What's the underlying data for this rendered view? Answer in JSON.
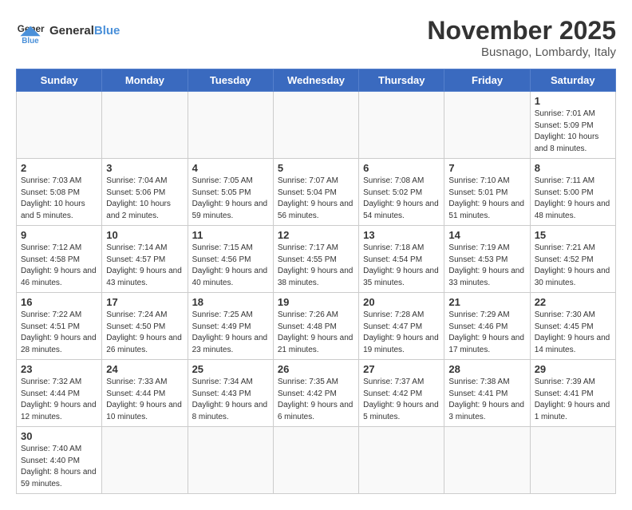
{
  "header": {
    "logo_general": "General",
    "logo_blue": "Blue",
    "month_title": "November 2025",
    "location": "Busnago, Lombardy, Italy"
  },
  "weekdays": [
    "Sunday",
    "Monday",
    "Tuesday",
    "Wednesday",
    "Thursday",
    "Friday",
    "Saturday"
  ],
  "weeks": [
    [
      {
        "day": "",
        "info": ""
      },
      {
        "day": "",
        "info": ""
      },
      {
        "day": "",
        "info": ""
      },
      {
        "day": "",
        "info": ""
      },
      {
        "day": "",
        "info": ""
      },
      {
        "day": "",
        "info": ""
      },
      {
        "day": "1",
        "info": "Sunrise: 7:01 AM\nSunset: 5:09 PM\nDaylight: 10 hours\nand 8 minutes."
      }
    ],
    [
      {
        "day": "2",
        "info": "Sunrise: 7:03 AM\nSunset: 5:08 PM\nDaylight: 10 hours\nand 5 minutes."
      },
      {
        "day": "3",
        "info": "Sunrise: 7:04 AM\nSunset: 5:06 PM\nDaylight: 10 hours\nand 2 minutes."
      },
      {
        "day": "4",
        "info": "Sunrise: 7:05 AM\nSunset: 5:05 PM\nDaylight: 9 hours\nand 59 minutes."
      },
      {
        "day": "5",
        "info": "Sunrise: 7:07 AM\nSunset: 5:04 PM\nDaylight: 9 hours\nand 56 minutes."
      },
      {
        "day": "6",
        "info": "Sunrise: 7:08 AM\nSunset: 5:02 PM\nDaylight: 9 hours\nand 54 minutes."
      },
      {
        "day": "7",
        "info": "Sunrise: 7:10 AM\nSunset: 5:01 PM\nDaylight: 9 hours\nand 51 minutes."
      },
      {
        "day": "8",
        "info": "Sunrise: 7:11 AM\nSunset: 5:00 PM\nDaylight: 9 hours\nand 48 minutes."
      }
    ],
    [
      {
        "day": "9",
        "info": "Sunrise: 7:12 AM\nSunset: 4:58 PM\nDaylight: 9 hours\nand 46 minutes."
      },
      {
        "day": "10",
        "info": "Sunrise: 7:14 AM\nSunset: 4:57 PM\nDaylight: 9 hours\nand 43 minutes."
      },
      {
        "day": "11",
        "info": "Sunrise: 7:15 AM\nSunset: 4:56 PM\nDaylight: 9 hours\nand 40 minutes."
      },
      {
        "day": "12",
        "info": "Sunrise: 7:17 AM\nSunset: 4:55 PM\nDaylight: 9 hours\nand 38 minutes."
      },
      {
        "day": "13",
        "info": "Sunrise: 7:18 AM\nSunset: 4:54 PM\nDaylight: 9 hours\nand 35 minutes."
      },
      {
        "day": "14",
        "info": "Sunrise: 7:19 AM\nSunset: 4:53 PM\nDaylight: 9 hours\nand 33 minutes."
      },
      {
        "day": "15",
        "info": "Sunrise: 7:21 AM\nSunset: 4:52 PM\nDaylight: 9 hours\nand 30 minutes."
      }
    ],
    [
      {
        "day": "16",
        "info": "Sunrise: 7:22 AM\nSunset: 4:51 PM\nDaylight: 9 hours\nand 28 minutes."
      },
      {
        "day": "17",
        "info": "Sunrise: 7:24 AM\nSunset: 4:50 PM\nDaylight: 9 hours\nand 26 minutes."
      },
      {
        "day": "18",
        "info": "Sunrise: 7:25 AM\nSunset: 4:49 PM\nDaylight: 9 hours\nand 23 minutes."
      },
      {
        "day": "19",
        "info": "Sunrise: 7:26 AM\nSunset: 4:48 PM\nDaylight: 9 hours\nand 21 minutes."
      },
      {
        "day": "20",
        "info": "Sunrise: 7:28 AM\nSunset: 4:47 PM\nDaylight: 9 hours\nand 19 minutes."
      },
      {
        "day": "21",
        "info": "Sunrise: 7:29 AM\nSunset: 4:46 PM\nDaylight: 9 hours\nand 17 minutes."
      },
      {
        "day": "22",
        "info": "Sunrise: 7:30 AM\nSunset: 4:45 PM\nDaylight: 9 hours\nand 14 minutes."
      }
    ],
    [
      {
        "day": "23",
        "info": "Sunrise: 7:32 AM\nSunset: 4:44 PM\nDaylight: 9 hours\nand 12 minutes."
      },
      {
        "day": "24",
        "info": "Sunrise: 7:33 AM\nSunset: 4:44 PM\nDaylight: 9 hours\nand 10 minutes."
      },
      {
        "day": "25",
        "info": "Sunrise: 7:34 AM\nSunset: 4:43 PM\nDaylight: 9 hours\nand 8 minutes."
      },
      {
        "day": "26",
        "info": "Sunrise: 7:35 AM\nSunset: 4:42 PM\nDaylight: 9 hours\nand 6 minutes."
      },
      {
        "day": "27",
        "info": "Sunrise: 7:37 AM\nSunset: 4:42 PM\nDaylight: 9 hours\nand 5 minutes."
      },
      {
        "day": "28",
        "info": "Sunrise: 7:38 AM\nSunset: 4:41 PM\nDaylight: 9 hours\nand 3 minutes."
      },
      {
        "day": "29",
        "info": "Sunrise: 7:39 AM\nSunset: 4:41 PM\nDaylight: 9 hours\nand 1 minute."
      }
    ],
    [
      {
        "day": "30",
        "info": "Sunrise: 7:40 AM\nSunset: 4:40 PM\nDaylight: 8 hours\nand 59 minutes."
      },
      {
        "day": "",
        "info": ""
      },
      {
        "day": "",
        "info": ""
      },
      {
        "day": "",
        "info": ""
      },
      {
        "day": "",
        "info": ""
      },
      {
        "day": "",
        "info": ""
      },
      {
        "day": "",
        "info": ""
      }
    ]
  ]
}
